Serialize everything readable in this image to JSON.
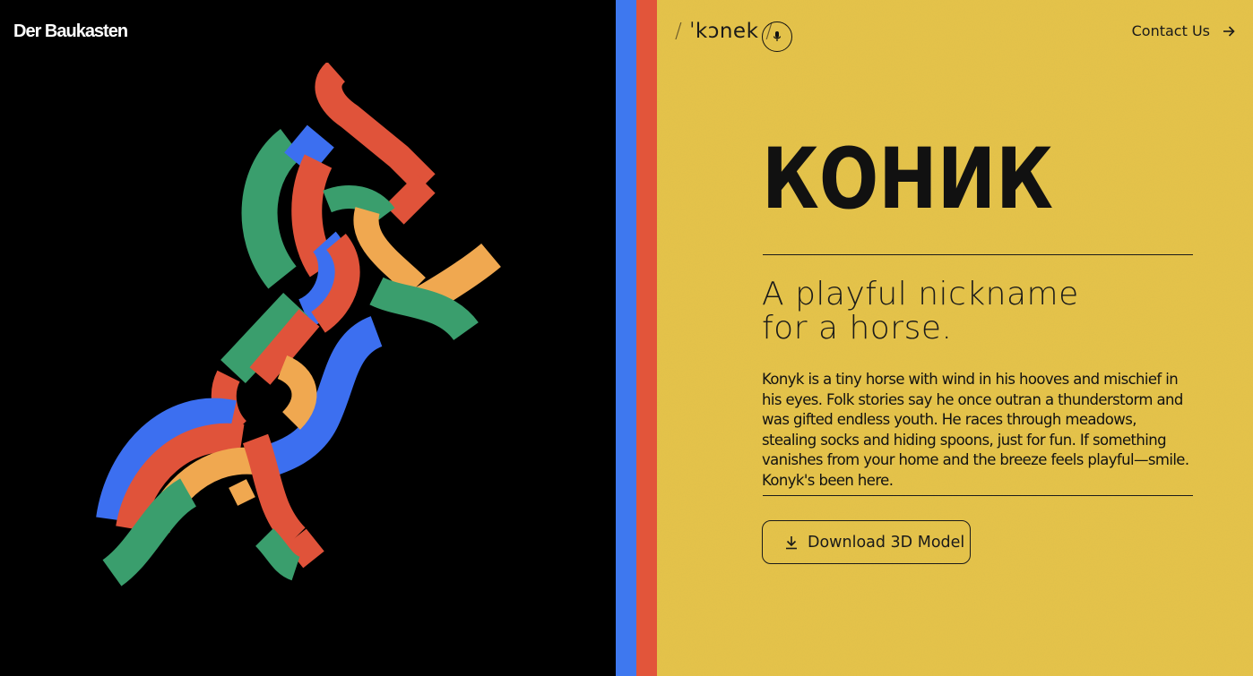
{
  "brand": {
    "name": "Der Baukasten"
  },
  "colors": {
    "background_left": "#000000",
    "stripe_blue": "#3e78ef",
    "stripe_red": "#e2553a",
    "yellow": "#e7c448",
    "piece_red": "#e0533a",
    "piece_green": "#3a9e6d",
    "piece_blue": "#3c6ff0",
    "piece_orange": "#f0a850",
    "ink": "#1a1a1a"
  },
  "header": {
    "pronunciation": "ˈkɔnek",
    "audio_icon": "microphone-icon",
    "contact_label": "Contact Us",
    "contact_icon": "arrow-right-icon"
  },
  "main": {
    "title": "КОНИК",
    "subtitle_lines": [
      "A playful nickname",
      "for a horse."
    ],
    "description": "Konyk is a tiny horse with wind in his hooves and mischief in his eyes. Folk stories say he once outran a thunderstorm and was gifted endless youth. He races through meadows, stealing socks and hiding spoons, just for fun. If something vanishes from your home and the breeze feels playful—smile. Konyk's been here.",
    "download_label": "Download 3D Model",
    "download_icon": "download-icon"
  }
}
